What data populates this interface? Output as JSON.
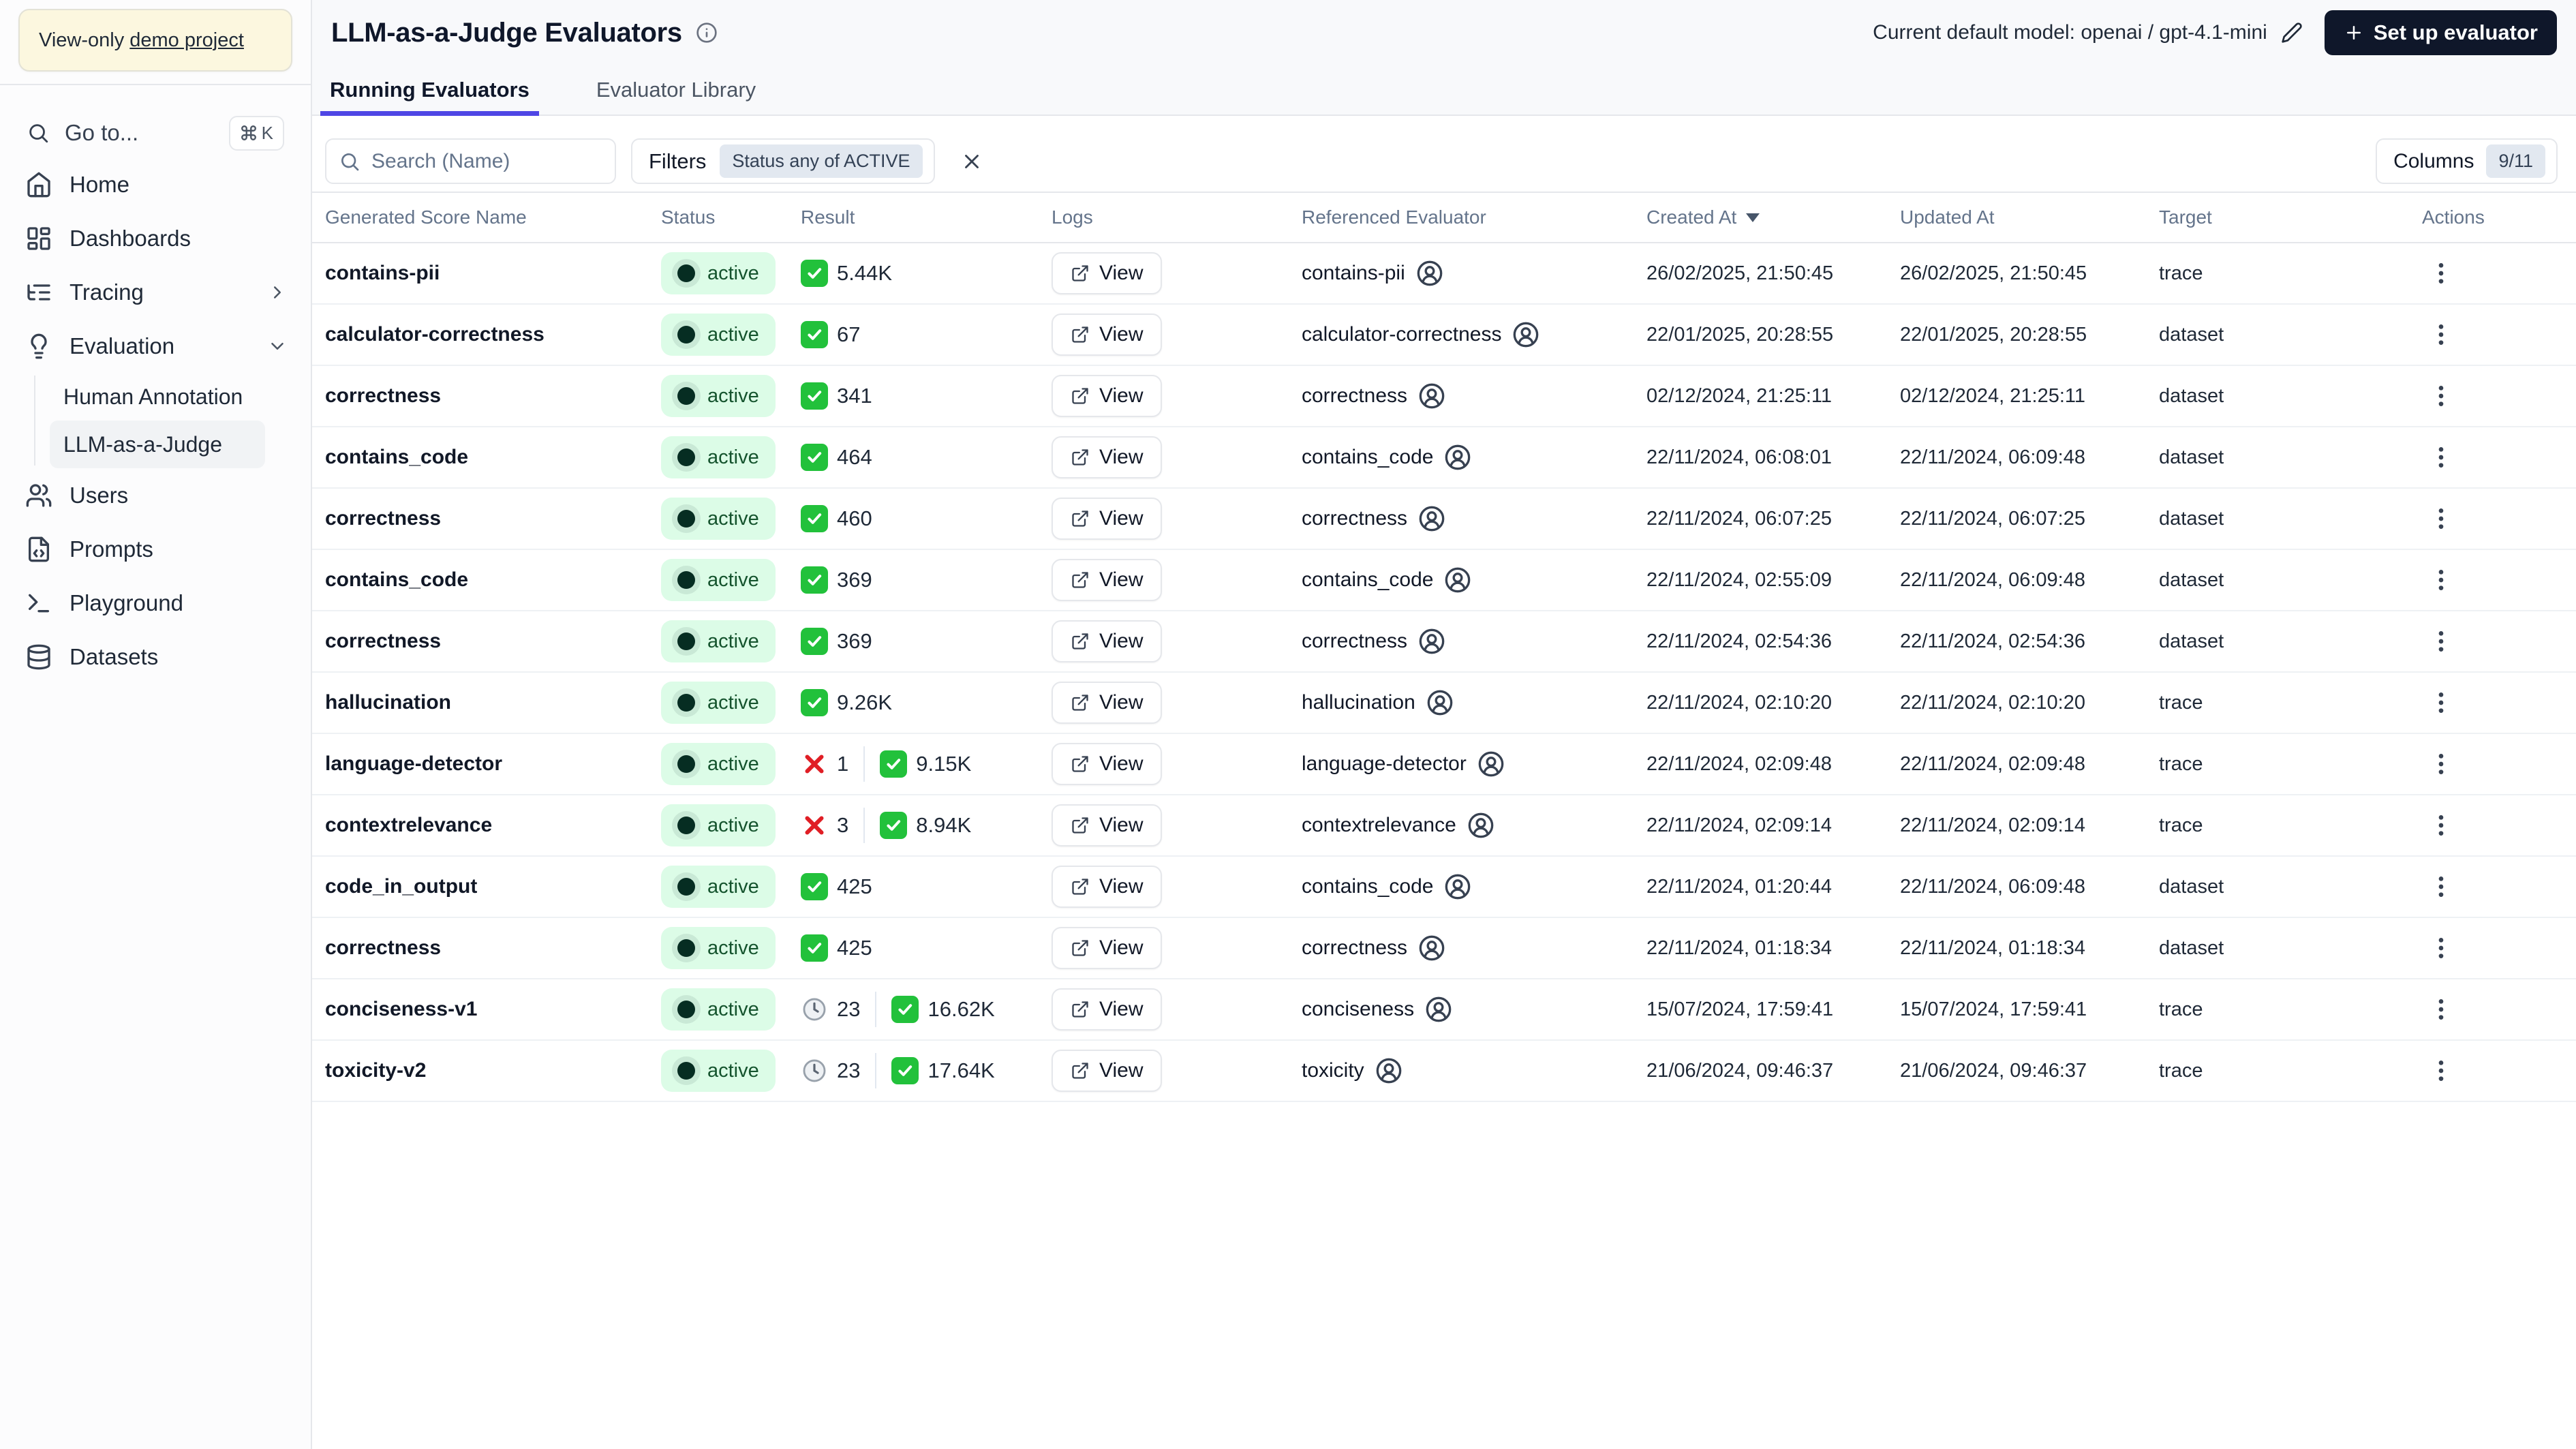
{
  "colors": {
    "accent": "#4f46e5",
    "active_badge_bg": "#dcfce7",
    "active_badge_text": "#14532d",
    "active_dot": "#062d22",
    "check_green": "#22c13b",
    "error_red": "#e01e25",
    "primary_button_bg": "#0f172a",
    "banner_bg": "#fcf7df"
  },
  "sidebar": {
    "banner": {
      "prefix": "View-only ",
      "link": "demo project"
    },
    "goto": {
      "label": "Go to...",
      "shortcut_key": "K"
    },
    "nav": [
      {
        "label": "Home"
      },
      {
        "label": "Dashboards"
      },
      {
        "label": "Tracing"
      },
      {
        "label": "Evaluation"
      },
      {
        "label": "Users"
      },
      {
        "label": "Prompts"
      },
      {
        "label": "Playground"
      },
      {
        "label": "Datasets"
      }
    ],
    "evaluation_children": [
      {
        "label": "Human Annotation"
      },
      {
        "label": "LLM-as-a-Judge",
        "active": true
      }
    ]
  },
  "header": {
    "title": "LLM-as-a-Judge Evaluators",
    "model_label": "Current default model: openai / gpt-4.1-mini",
    "setup_button": "Set up evaluator"
  },
  "tabs": [
    {
      "label": "Running Evaluators",
      "active": true
    },
    {
      "label": "Evaluator Library",
      "active": false
    }
  ],
  "toolbar": {
    "search_placeholder": "Search (Name)",
    "filters_label": "Filters",
    "filters_badge": "Status any of ACTIVE",
    "columns_label": "Columns",
    "columns_badge": "9/11"
  },
  "table": {
    "columns": [
      "Generated Score Name",
      "Status",
      "Result",
      "Logs",
      "Referenced Evaluator",
      "Created At",
      "Updated At",
      "Target",
      "Actions"
    ],
    "sorted_column": "Created At",
    "sort_direction": "desc",
    "view_label": "View",
    "rows": [
      {
        "name": "contains-pii",
        "status": "active",
        "result": [
          {
            "icon": "check",
            "value": "5.44K"
          }
        ],
        "referenced": "contains-pii",
        "created_at": "26/02/2025, 21:50:45",
        "updated_at": "26/02/2025, 21:50:45",
        "target": "trace"
      },
      {
        "name": "calculator-correctness",
        "status": "active",
        "result": [
          {
            "icon": "check",
            "value": "67"
          }
        ],
        "referenced": "calculator-correctness",
        "created_at": "22/01/2025, 20:28:55",
        "updated_at": "22/01/2025, 20:28:55",
        "target": "dataset"
      },
      {
        "name": "correctness",
        "status": "active",
        "result": [
          {
            "icon": "check",
            "value": "341"
          }
        ],
        "referenced": "correctness",
        "created_at": "02/12/2024, 21:25:11",
        "updated_at": "02/12/2024, 21:25:11",
        "target": "dataset"
      },
      {
        "name": "contains_code",
        "status": "active",
        "result": [
          {
            "icon": "check",
            "value": "464"
          }
        ],
        "referenced": "contains_code",
        "created_at": "22/11/2024, 06:08:01",
        "updated_at": "22/11/2024, 06:09:48",
        "target": "dataset"
      },
      {
        "name": "correctness",
        "status": "active",
        "result": [
          {
            "icon": "check",
            "value": "460"
          }
        ],
        "referenced": "correctness",
        "created_at": "22/11/2024, 06:07:25",
        "updated_at": "22/11/2024, 06:07:25",
        "target": "dataset"
      },
      {
        "name": "contains_code",
        "status": "active",
        "result": [
          {
            "icon": "check",
            "value": "369"
          }
        ],
        "referenced": "contains_code",
        "created_at": "22/11/2024, 02:55:09",
        "updated_at": "22/11/2024, 06:09:48",
        "target": "dataset"
      },
      {
        "name": "correctness",
        "status": "active",
        "result": [
          {
            "icon": "check",
            "value": "369"
          }
        ],
        "referenced": "correctness",
        "created_at": "22/11/2024, 02:54:36",
        "updated_at": "22/11/2024, 02:54:36",
        "target": "dataset"
      },
      {
        "name": "hallucination",
        "status": "active",
        "result": [
          {
            "icon": "check",
            "value": "9.26K"
          }
        ],
        "referenced": "hallucination",
        "created_at": "22/11/2024, 02:10:20",
        "updated_at": "22/11/2024, 02:10:20",
        "target": "trace"
      },
      {
        "name": "language-detector",
        "status": "active",
        "result": [
          {
            "icon": "x",
            "value": "1"
          },
          {
            "icon": "check",
            "value": "9.15K"
          }
        ],
        "referenced": "language-detector",
        "created_at": "22/11/2024, 02:09:48",
        "updated_at": "22/11/2024, 02:09:48",
        "target": "trace"
      },
      {
        "name": "contextrelevance",
        "status": "active",
        "result": [
          {
            "icon": "x",
            "value": "3"
          },
          {
            "icon": "check",
            "value": "8.94K"
          }
        ],
        "referenced": "contextrelevance",
        "created_at": "22/11/2024, 02:09:14",
        "updated_at": "22/11/2024, 02:09:14",
        "target": "trace"
      },
      {
        "name": "code_in_output",
        "status": "active",
        "result": [
          {
            "icon": "check",
            "value": "425"
          }
        ],
        "referenced": "contains_code",
        "created_at": "22/11/2024, 01:20:44",
        "updated_at": "22/11/2024, 06:09:48",
        "target": "dataset"
      },
      {
        "name": "correctness",
        "status": "active",
        "result": [
          {
            "icon": "check",
            "value": "425"
          }
        ],
        "referenced": "correctness",
        "created_at": "22/11/2024, 01:18:34",
        "updated_at": "22/11/2024, 01:18:34",
        "target": "dataset"
      },
      {
        "name": "conciseness-v1",
        "status": "active",
        "result": [
          {
            "icon": "clock",
            "value": "23"
          },
          {
            "icon": "check",
            "value": "16.62K"
          }
        ],
        "referenced": "conciseness",
        "created_at": "15/07/2024, 17:59:41",
        "updated_at": "15/07/2024, 17:59:41",
        "target": "trace"
      },
      {
        "name": "toxicity-v2",
        "status": "active",
        "result": [
          {
            "icon": "clock",
            "value": "23"
          },
          {
            "icon": "check",
            "value": "17.64K"
          }
        ],
        "referenced": "toxicity",
        "created_at": "21/06/2024, 09:46:37",
        "updated_at": "21/06/2024, 09:46:37",
        "target": "trace"
      }
    ]
  }
}
